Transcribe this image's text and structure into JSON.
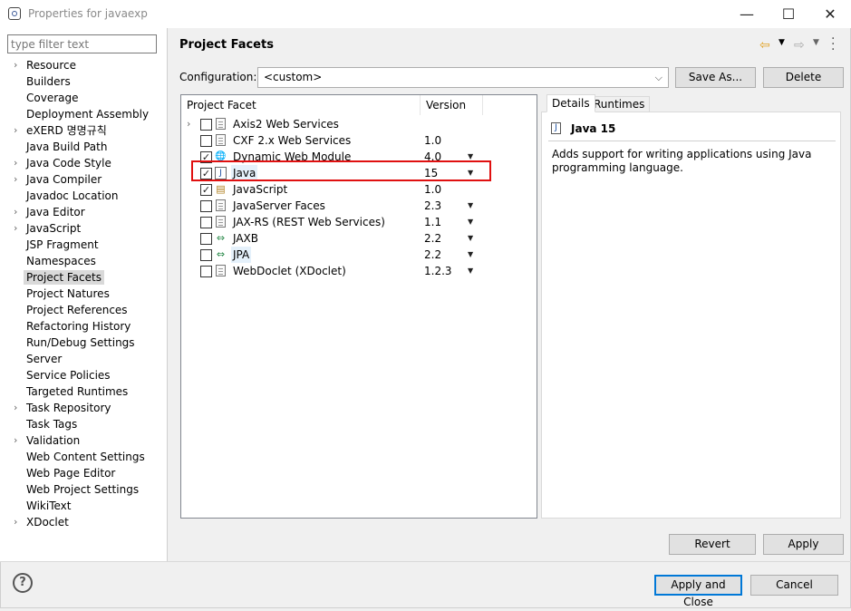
{
  "window": {
    "title": "Properties for javaexp",
    "minimize": "—",
    "maximize": "☐",
    "close": "✕"
  },
  "filter": {
    "placeholder": "type filter text"
  },
  "nav": [
    {
      "label": "Resource",
      "expandable": true
    },
    {
      "label": "Builders",
      "expandable": false
    },
    {
      "label": "Coverage",
      "expandable": false
    },
    {
      "label": "Deployment Assembly",
      "expandable": false
    },
    {
      "label": "eXERD 명명규칙",
      "expandable": true
    },
    {
      "label": "Java Build Path",
      "expandable": false
    },
    {
      "label": "Java Code Style",
      "expandable": true
    },
    {
      "label": "Java Compiler",
      "expandable": true
    },
    {
      "label": "Javadoc Location",
      "expandable": false
    },
    {
      "label": "Java Editor",
      "expandable": true
    },
    {
      "label": "JavaScript",
      "expandable": true
    },
    {
      "label": "JSP Fragment",
      "expandable": false
    },
    {
      "label": "Namespaces",
      "expandable": false
    },
    {
      "label": "Project Facets",
      "expandable": false,
      "selected": true
    },
    {
      "label": "Project Natures",
      "expandable": false
    },
    {
      "label": "Project References",
      "expandable": false
    },
    {
      "label": "Refactoring History",
      "expandable": false
    },
    {
      "label": "Run/Debug Settings",
      "expandable": false
    },
    {
      "label": "Server",
      "expandable": false
    },
    {
      "label": "Service Policies",
      "expandable": false
    },
    {
      "label": "Targeted Runtimes",
      "expandable": false
    },
    {
      "label": "Task Repository",
      "expandable": true
    },
    {
      "label": "Task Tags",
      "expandable": false
    },
    {
      "label": "Validation",
      "expandable": true
    },
    {
      "label": "Web Content Settings",
      "expandable": false
    },
    {
      "label": "Web Page Editor",
      "expandable": false
    },
    {
      "label": "Web Project Settings",
      "expandable": false
    },
    {
      "label": "WikiText",
      "expandable": false
    },
    {
      "label": "XDoclet",
      "expandable": true
    }
  ],
  "page": {
    "title": "Project Facets"
  },
  "config": {
    "label": "Configuration:",
    "value": "<custom>",
    "save_as": "Save As...",
    "delete": "Delete"
  },
  "facets": {
    "col_facet": "Project Facet",
    "col_version": "Version",
    "rows": [
      {
        "name": "Axis2 Web Services",
        "version": "",
        "checked": false,
        "expandable": true,
        "icon": "doc"
      },
      {
        "name": "CXF 2.x Web Services",
        "version": "1.0",
        "checked": false,
        "expandable": false,
        "icon": "doc"
      },
      {
        "name": "Dynamic Web Module",
        "version": "4.0",
        "checked": true,
        "expandable": false,
        "icon": "web-module",
        "dropdown": true
      },
      {
        "name": "Java",
        "version": "15",
        "checked": true,
        "expandable": false,
        "icon": "java",
        "dropdown": true,
        "highlight": true
      },
      {
        "name": "JavaScript",
        "version": "1.0",
        "checked": true,
        "expandable": false,
        "icon": "lock-doc"
      },
      {
        "name": "JavaServer Faces",
        "version": "2.3",
        "checked": false,
        "expandable": false,
        "icon": "doc",
        "dropdown": true
      },
      {
        "name": "JAX-RS (REST Web Services)",
        "version": "1.1",
        "checked": false,
        "expandable": false,
        "icon": "doc",
        "dropdown": true
      },
      {
        "name": "JAXB",
        "version": "2.2",
        "checked": false,
        "expandable": false,
        "icon": "swap",
        "dropdown": true
      },
      {
        "name": "JPA",
        "version": "2.2",
        "checked": false,
        "expandable": false,
        "icon": "swap",
        "dropdown": true,
        "hl_name": true
      },
      {
        "name": "WebDoclet (XDoclet)",
        "version": "1.2.3",
        "checked": false,
        "expandable": false,
        "icon": "doc",
        "dropdown": true
      }
    ]
  },
  "details": {
    "tab_details": "Details",
    "tab_runtimes": "Runtimes",
    "title": "Java 15",
    "description": "Adds support for writing applications using Java programming language."
  },
  "buttons": {
    "revert": "Revert",
    "apply": "Apply",
    "apply_close": "Apply and Close",
    "cancel": "Cancel",
    "help": "?"
  },
  "colors": {
    "highlight_box": "#e01010",
    "selection": "#d9d9d9",
    "focus": "#0078d7"
  }
}
